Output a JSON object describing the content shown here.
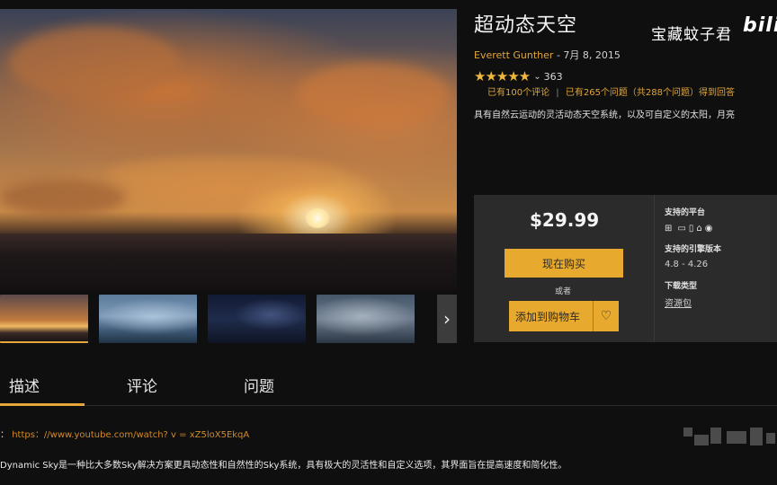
{
  "product": {
    "title": "超动态天空",
    "author": "Everett Gunther",
    "date": "7月 8, 2015",
    "stars": "★★★★★",
    "rating_count": "363",
    "reviews_text": "已有100个评论",
    "questions_text": "已有265个问题（共288个问题）得到回答",
    "short_description": "具有自然云运动的灵活动态天空系统，以及可自定义的太阳，月亮"
  },
  "watermark": {
    "uploader": "宝藏蚊子君",
    "site_logo": "bili"
  },
  "purchase": {
    "price": "$29.99",
    "buy_now_label": "现在购买",
    "or_label": "或者",
    "add_to_cart_label": "添加到购物车",
    "platforms_label": "支持的平台",
    "engine_versions_label": "支持的引擎版本",
    "engine_versions": "4.8 - 4.26",
    "download_type_label": "下载类型",
    "download_type": "资源包"
  },
  "tabs": [
    {
      "label": "描述",
      "active": true
    },
    {
      "label": "评论",
      "active": false
    },
    {
      "label": "问题",
      "active": false
    }
  ],
  "description": {
    "video_prefix": "：",
    "video_link": "https：//www.youtube.com/watch? v = xZ5loX5EkqA",
    "body": "Dynamic Sky是一种比大多数Sky解决方案更具动态性和自然性的Sky系统，具有极大的灵活性和自定义选项，其界面旨在提高速度和简化性。"
  },
  "colors": {
    "accent": "#e7a63a",
    "panel": "#2b2b2b",
    "background": "#0f0f0f"
  },
  "icons": {
    "platforms": [
      "windows-icon",
      "apple-icon",
      "monitor-icon",
      "mobile-icon",
      "android-icon",
      "vr-eye-icon"
    ],
    "next_arrow": "chevron-right-icon",
    "favorite": "heart-icon"
  }
}
